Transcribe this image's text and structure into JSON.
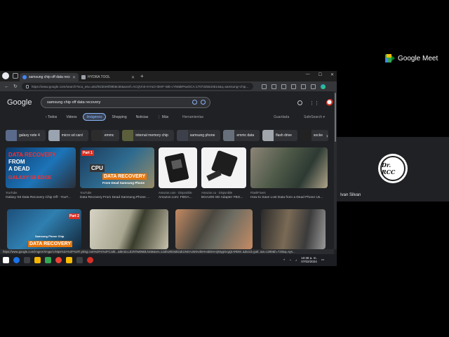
{
  "meet": {
    "label": "Google Meet"
  },
  "participant": {
    "avatar_text": "Dr. RCC",
    "name": "Ivan Silvan"
  },
  "browser": {
    "tabs": [
      {
        "label": "samsung chip off data recovery",
        "active": true
      },
      {
        "label": "HYDRA TOOL",
        "active": false
      }
    ],
    "new_tab": "+",
    "window_controls": [
      "—",
      "☐",
      "✕"
    ],
    "url": "https://www.google.com/search?sca_esv=a51f91b0e9f39b8c56&sxsrf=ACQVn0-rnYuO-IDHF-WE-cYN6BPAwOCA:1707325643514&q=samsung+chip...",
    "status_url": "https://www.google.com/imgres?imgurl=https%3A%2F%2Fi.ytimg.com%2Fvi%2FCzd8...&tbnid=LE2NTwt9MdLNcM&vet=12ahUKEwi62ub1lmEAxWiAebIHHabDHAQMygGegQIARBW..&docid=guE..&w=1280&h=720&q=sys..."
  },
  "google": {
    "logo": "Google",
    "query": "samsung chip off data recovery",
    "filters": [
      "‹ Todos",
      "Videos",
      "Imágenes",
      "Shopping",
      "Noticias",
      "⋮ Más"
    ],
    "active_filter": "Imágenes",
    "tools": "Herramientas",
    "saved": "Guardada",
    "safesearch": "SafeSearch ▾",
    "chips": [
      {
        "label": "galaxy note 4",
        "color": "#5a6a8a"
      },
      {
        "label": "micro sd card",
        "color": "#9aa3b0"
      },
      {
        "label": "emmc",
        "color": "#2c2c2c"
      },
      {
        "label": "internal memory chip",
        "color": "#5b5f3b"
      },
      {
        "label": "samsung phone",
        "color": "#3d3f4a"
      },
      {
        "label": "emmc data",
        "color": "#67707a"
      },
      {
        "label": "flash drive",
        "color": "#a0a6ac"
      },
      {
        "label": "socke",
        "color": "#222222"
      }
    ],
    "results_row1": [
      {
        "source": "YouTube",
        "title": "Galaxy S6 Data Recovery Chip Off - YouT...",
        "overlay1": "DATA RECOVERY",
        "overlay2": "FROM",
        "overlay3": "A DEAD",
        "overlay4": "GALAXY S6 EDGE"
      },
      {
        "source": "YouTube",
        "title": "Data Recovery From Dead Samsung Phone ...",
        "overlay1": "CPU",
        "overlay2": "DATA RECOVERY",
        "overlay3": "From Dead Samsung Phone",
        "overlay4": "Part 1"
      },
      {
        "source": "Amazon.com · Disponible",
        "title": "Amazon.com: FBGA..."
      },
      {
        "source": "Amazon.ca · Disponible",
        "title": "BGA200-SD Adapter FBG..."
      },
      {
        "source": "FlashFixers",
        "title": "How to Save Lost Data from a Dead Phone Us..."
      }
    ],
    "results_row2": [
      {
        "overlay1": "DATA RECOVERY",
        "overlay2": "Samsung Phone Chip",
        "overlay3": "Part 2"
      },
      {},
      {},
      {}
    ]
  },
  "taskbar": {
    "clock_time": "10:38 a. m.",
    "clock_date": "07/02/2024"
  }
}
